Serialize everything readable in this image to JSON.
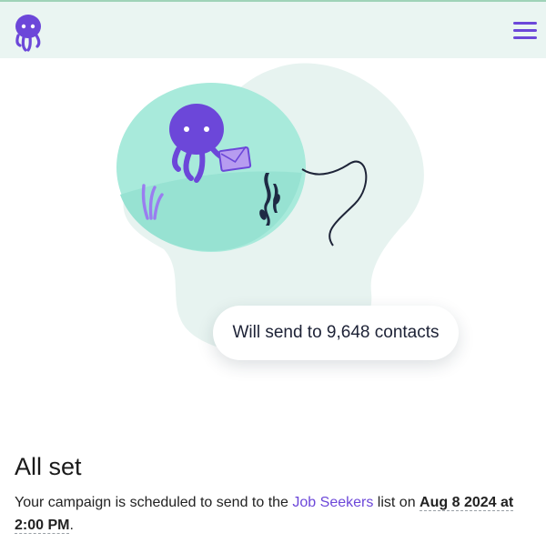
{
  "header": {
    "logo_icon": "octopus-logo-icon",
    "menu_icon": "hamburger-menu-icon"
  },
  "illustration": {
    "send_count_text": "Will send to 9,648 contacts",
    "icons": [
      "octopus-icon",
      "envelope-icon",
      "seaweed-icon",
      "coral-icon"
    ]
  },
  "status": {
    "title": "All set",
    "desc_prefix": "Your campaign is scheduled to send to the",
    "list_name": "Job Seekers",
    "desc_middle": "list on",
    "schedule_date": "Aug 8 2024 at 2:00 PM",
    "desc_suffix": "."
  },
  "colors": {
    "accent": "#6c47d9",
    "topbar_bg": "#eaf5f2",
    "teal": "#a8eadb"
  }
}
